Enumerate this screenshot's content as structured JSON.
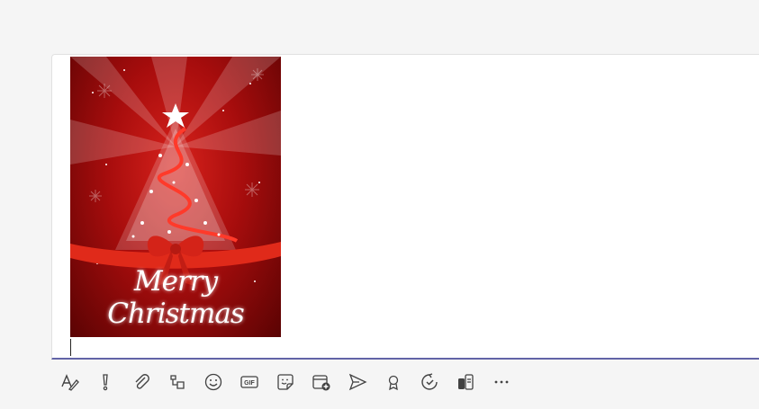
{
  "compose": {
    "image": {
      "greeting": "Merry Christmas",
      "colors": {
        "background": "#b00f0f",
        "ribbon": "#e02a1a",
        "sparkle": "#ffffff"
      }
    },
    "accent": "#6264a7"
  },
  "toolbar": {
    "buttons": [
      {
        "name": "format-icon"
      },
      {
        "name": "important-icon"
      },
      {
        "name": "attach-icon"
      },
      {
        "name": "loop-component-icon"
      },
      {
        "name": "emoji-icon"
      },
      {
        "name": "gif-icon",
        "text": "GIF"
      },
      {
        "name": "sticker-icon"
      },
      {
        "name": "schedule-meeting-icon"
      },
      {
        "name": "stream-icon"
      },
      {
        "name": "praise-icon"
      },
      {
        "name": "approvals-icon"
      },
      {
        "name": "updates-icon"
      },
      {
        "name": "more-options-icon"
      }
    ]
  }
}
